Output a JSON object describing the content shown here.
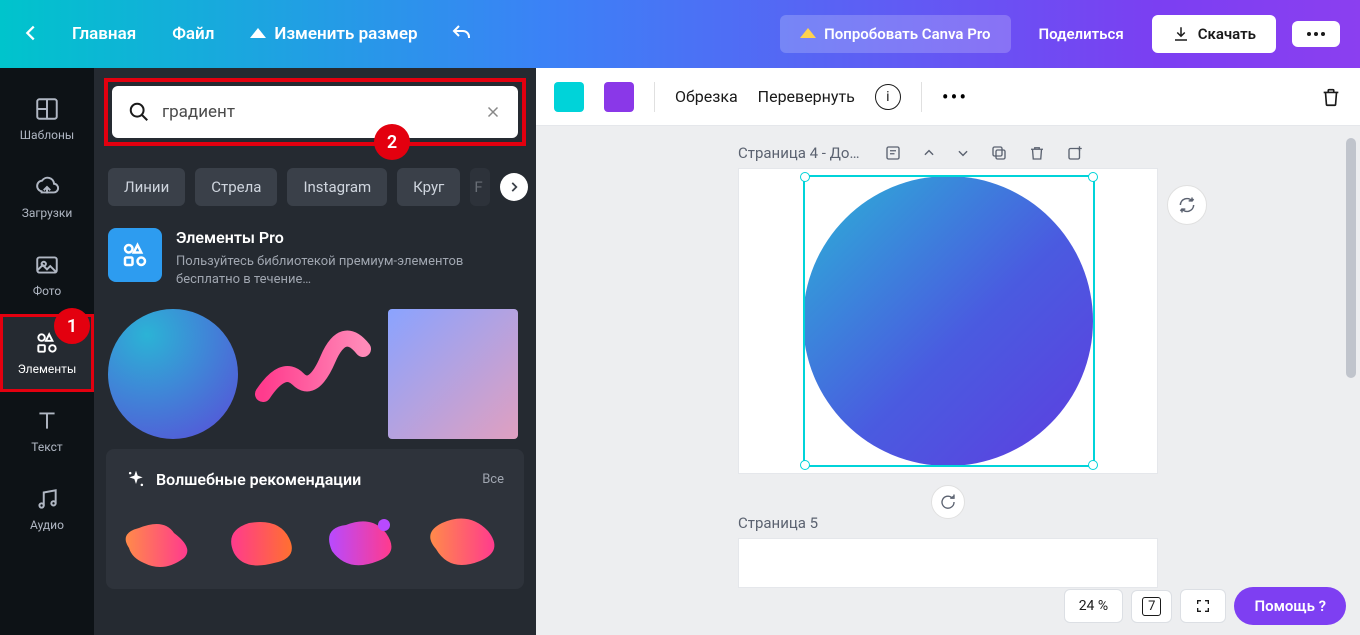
{
  "topbar": {
    "home": "Главная",
    "file": "Файл",
    "resize": "Изменить размер",
    "try_pro": "Попробовать Canva Pro",
    "share": "Поделиться",
    "download": "Скачать"
  },
  "rail": {
    "templates": "Шаблоны",
    "uploads": "Загрузки",
    "photo": "Фото",
    "elements": "Элементы",
    "text": "Текст",
    "audio": "Аудио"
  },
  "search": {
    "value": "градиент"
  },
  "chips": [
    "Линии",
    "Стрела",
    "Instagram",
    "Круг",
    "F"
  ],
  "pro_promo": {
    "title": "Элементы Pro",
    "desc": "Пользуйтесь библиотекой премиум-элементов бесплатно в течение…"
  },
  "magic": {
    "title": "Волшебные рекомендации",
    "all": "Все"
  },
  "toolbar": {
    "crop": "Обрезка",
    "flip": "Перевернуть"
  },
  "pages": {
    "p4": "Страница 4 - До…",
    "p5": "Страница 5"
  },
  "zoom": "24 %",
  "pagecount": "7",
  "help": "Помощь  ?",
  "annotations": {
    "badge1": "1",
    "badge2": "2"
  },
  "colors": {
    "sw1": "#00d3d9",
    "sw2": "#8a38e8"
  }
}
